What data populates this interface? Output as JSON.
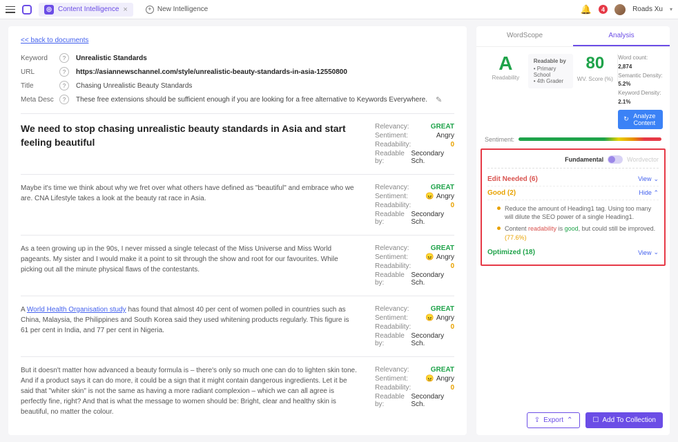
{
  "topbar": {
    "tab_label": "Content Intelligence",
    "new_intelligence": "New Intelligence",
    "notification_count": "4",
    "username": "Roads Xu"
  },
  "back_link": "<< back to documents",
  "meta": {
    "keyword_label": "Keyword",
    "keyword_value": "Unrealistic Standards",
    "url_label": "URL",
    "url_value": "https://asiannewschannel.com/style/unrealistic-beauty-standards-in-asia-12550800",
    "title_label": "Title",
    "title_value": "Chasing Unrealistic Beauty Standards",
    "meta_desc_label": "Meta Desc",
    "meta_desc_value": "These free extensions should be sufficient enough if you are looking for a free alternative to Keywords Everywhere."
  },
  "blocks": [
    {
      "heading": "We need to stop chasing unrealistic beauty standards in Asia and start feeling beautiful"
    },
    {
      "text": "Maybe it's time we think about why we fret over what others have defined as \"beautiful\" and embrace who we are. CNA Lifestyle takes a look at the beauty rat race in Asia."
    },
    {
      "text_pre": "As a teen growing up in the 90s, I never missed a single telecast of the Miss Universe and Miss World pageants. My sister and I would make it a point to sit through the show and root for our favourites. While picking out all the minute physical flaws of the contestants."
    },
    {
      "text_link_prefix": "A ",
      "link_text": "World Health Organisation study",
      "text_link_suffix": " has found that almost 40 per cent of women polled in countries such as China, Malaysia, the Philippines and South Korea said they used whitening products regularly. This figure is 61 per cent in India, and 77 per cent in Nigeria."
    },
    {
      "text": "But it doesn't matter how advanced a beauty formula is – there's only so much one can do to lighten skin tone. And if a product says it can do more, it could be a sign that it might contain dangerous ingredients. Let it be said that \"whiter skin\" is not the same as having a more radiant complexion – which we can all agree is perfectly fine, right? And that is what the message to women should be: Bright, clear and healthy skin is beautiful, no matter the colour."
    }
  ],
  "metrics_labels": {
    "relevancy": "Relevancy:",
    "sentiment": "Sentiment:",
    "readability": "Readability:",
    "readable_by": "Readable by:"
  },
  "metrics_values": {
    "relevancy": "GREAT",
    "sentiment": "Angry",
    "readability": "0",
    "readable_by": "Secondary Sch."
  },
  "analysis": {
    "tab_wordscope": "WordScope",
    "tab_analysis": "Analysis",
    "grade": "A",
    "grade_label": "Readability",
    "readable_by_header": "Readable by",
    "readable_by_1": "Primary School",
    "readable_by_2": "4th Grader",
    "wvscore": "80",
    "wvscore_label": "WV. Score (%)",
    "wordcount_label": "Word count:",
    "wordcount": "2,874",
    "semantic_label": "Semantic Density:",
    "semantic": "5.2%",
    "keyword_label": "Keyword Density:",
    "keyword": "2.1%",
    "analyze_btn": "Analyze Content",
    "sentiment_label": "Sentiment:",
    "fundamental": "Fundamental",
    "wordvector": "Wordvector",
    "edit_needed": "Edit Needed (6)",
    "good": "Good (2)",
    "optimized": "Optimized (18)",
    "view": "View",
    "hide": "Hide",
    "hint1": "Reduce the amount of Heading1 tag. Using too many will dilute the SEO power of a single Heading1.",
    "hint2_pre": "Content ",
    "hint2_r": "readability",
    "hint2_mid": " is ",
    "hint2_g": "good",
    "hint2_suf": ", but could still be improved. ",
    "hint2_pct": "(77.6%)",
    "export": "Export",
    "add": "Add To Collection"
  }
}
